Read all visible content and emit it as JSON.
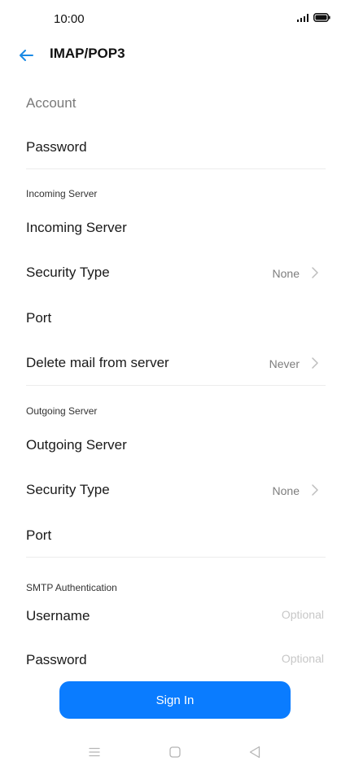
{
  "status_bar": {
    "time": "10:00",
    "icons": [
      "signal-icon",
      "battery-icon"
    ]
  },
  "header": {
    "title": "IMAP/POP3",
    "back_icon": "back-arrow-icon"
  },
  "colors": {
    "accent": "#0a7cff",
    "back_arrow": "#1a8ae5"
  },
  "account": {
    "account_label": "Account",
    "password_label": "Password"
  },
  "incoming": {
    "section_title": "Incoming Server",
    "server_label": "Incoming Server",
    "security_label": "Security Type",
    "security_value": "None",
    "port_label": "Port",
    "delete_label": "Delete mail from server",
    "delete_value": "Never"
  },
  "outgoing": {
    "section_title": "Outgoing Server",
    "server_label": "Outgoing Server",
    "security_label": "Security Type",
    "security_value": "None",
    "port_label": "Port"
  },
  "smtp": {
    "section_title": "SMTP Authentication",
    "username_label": "Username",
    "username_placeholder": "Optional",
    "password_label": "Password",
    "password_placeholder": "Optional"
  },
  "actions": {
    "sign_in_label": "Sign In"
  },
  "nav": {
    "icons": [
      "menu-icon",
      "home-icon",
      "back-icon"
    ]
  }
}
